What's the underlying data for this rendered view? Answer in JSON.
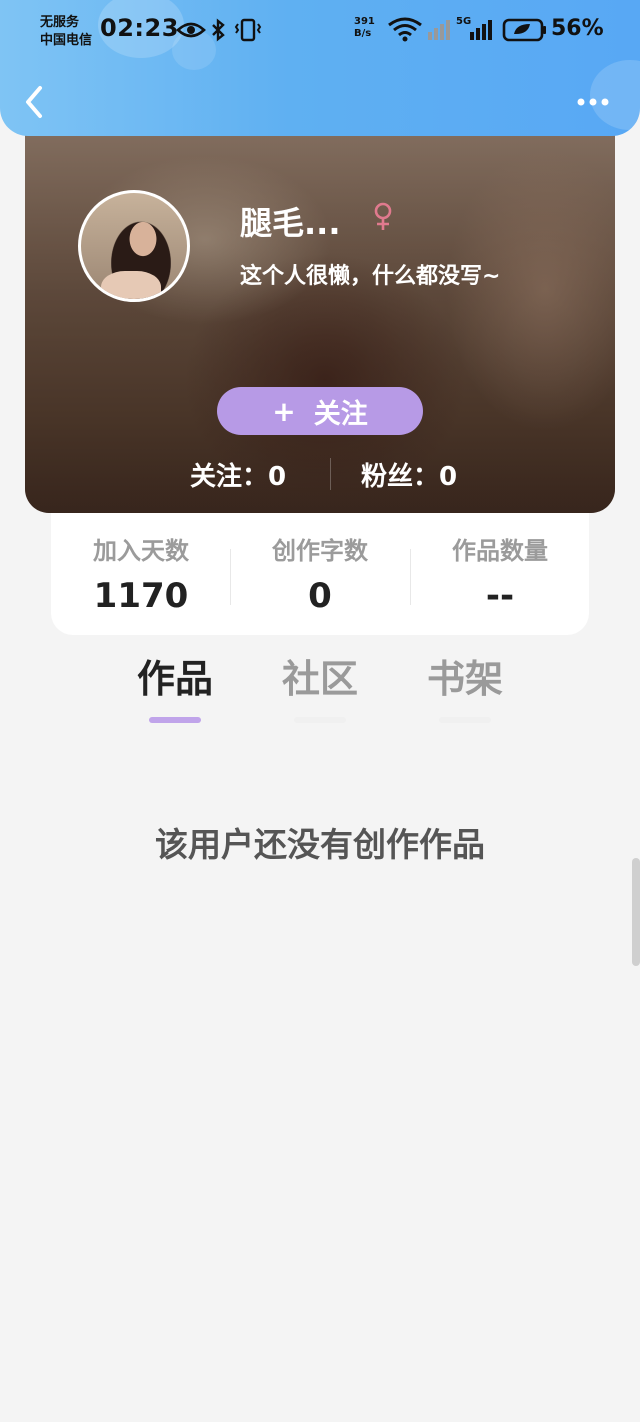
{
  "status_bar": {
    "carrier_line1": "无服务",
    "carrier_line2": "中国电信",
    "time": "02:23",
    "net_speed_value": "391",
    "net_speed_unit": "B/s",
    "signal_label": "5G",
    "battery_percent": "56%",
    "icons": [
      "eye-icon",
      "bluetooth-icon",
      "vibrate-icon",
      "wifi-icon",
      "signal-icon",
      "battery-icon"
    ]
  },
  "nav": {
    "back_icon": "chevron-left-icon",
    "more_icon": "more-dots-icon"
  },
  "profile": {
    "username": "腿毛...",
    "gender_icon": "female-icon",
    "bio": "这个人很懒，什么都没写~",
    "follow_button": "关注",
    "following_label": "关注：",
    "following_count": "0",
    "fans_label": "粉丝：",
    "fans_count": "0"
  },
  "stats": [
    {
      "label": "加入天数",
      "value": "1170"
    },
    {
      "label": "创作字数",
      "value": "0"
    },
    {
      "label": "作品数量",
      "value": "--"
    }
  ],
  "tabs": [
    {
      "label": "作品",
      "active": true
    },
    {
      "label": "社区",
      "active": false
    },
    {
      "label": "书架",
      "active": false
    }
  ],
  "empty_message": "该用户还没有创作作品",
  "colors": {
    "header": "#5fb0f2",
    "accent": "#b79ae6",
    "gender": "#e07a8e"
  }
}
